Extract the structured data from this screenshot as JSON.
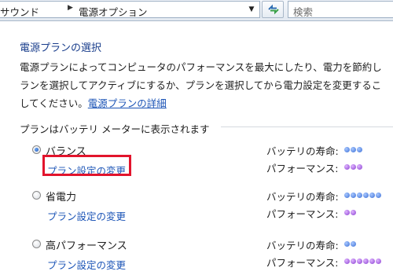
{
  "address_bar": {
    "crumbs": [
      "サウンド",
      "電源オプション"
    ],
    "separator_icon": "chevron-right-icon",
    "dropdown_icon": "chevron-down-icon",
    "refresh_icon": "refresh-icon"
  },
  "search": {
    "placeholder": "検索"
  },
  "content": {
    "heading": "電源プランの選択",
    "description_lines": [
      "電源プランによってコンピュータのパフォーマンスを最大にしたり、電力を節約し",
      "ランを選択してアクティブにするか、プランを選択してから電力設定を変更するこ",
      "してください。"
    ],
    "description_link": "電源プランの詳細",
    "group_title": "プランはバッテリ メーターに表示されます"
  },
  "plans": [
    {
      "name": "バランス",
      "selected": true,
      "link": "プラン設定の変更",
      "battery_label": "バッテリの寿命:",
      "battery_level": 3,
      "performance_label": "パフォーマンス:",
      "performance_level": 3
    },
    {
      "name": "省電力",
      "selected": false,
      "link": "プラン設定の変更",
      "battery_label": "バッテリの寿命:",
      "battery_level": 6,
      "performance_label": "パフォーマンス:",
      "performance_level": 2
    },
    {
      "name": "高パフォーマンス",
      "selected": false,
      "link": "プラン設定の変更",
      "battery_label": "バッテリの寿命:",
      "battery_level": 2,
      "performance_label": "パフォーマンス:",
      "performance_level": 6
    }
  ],
  "colors": {
    "link": "#1a53b6",
    "highlight": "#e2142c",
    "battery_dots": "#3b6fd6",
    "performance_dots": "#8a3fd1"
  }
}
